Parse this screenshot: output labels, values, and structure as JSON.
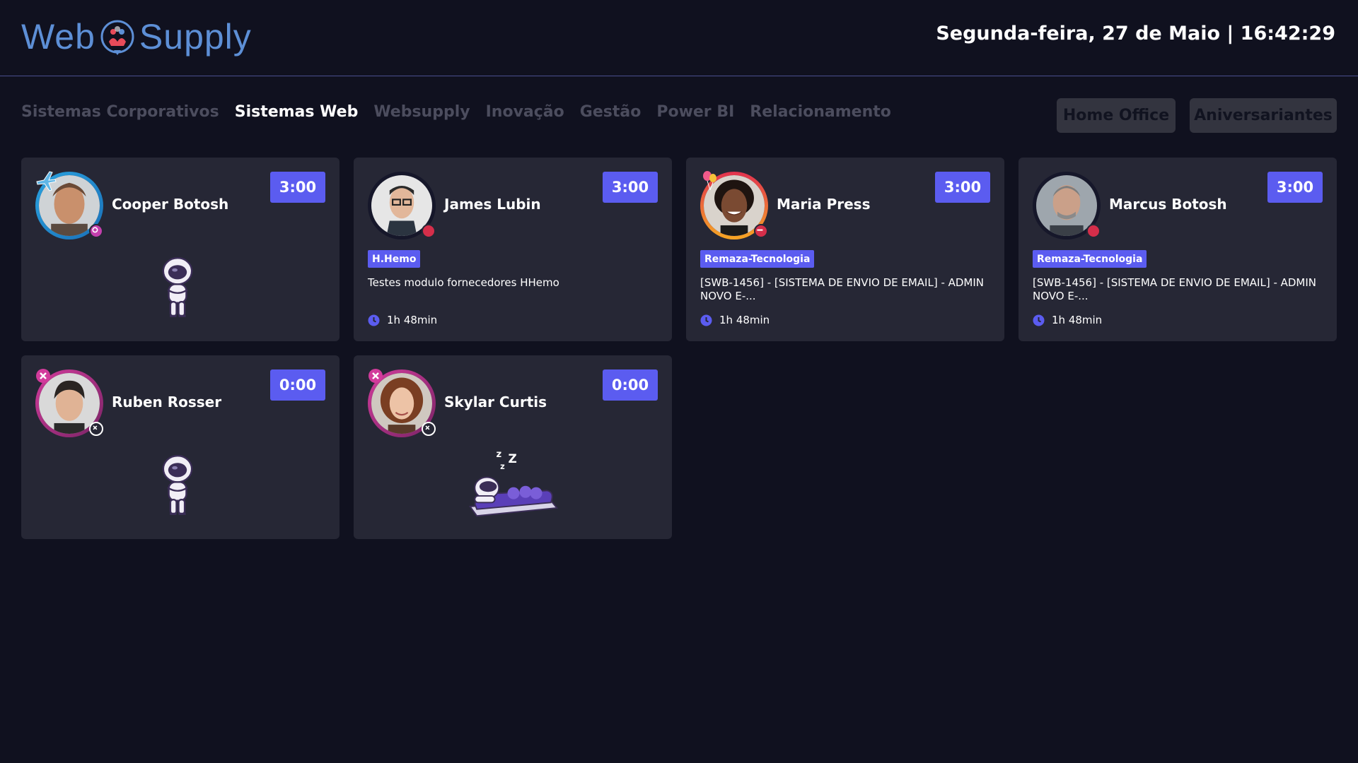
{
  "header": {
    "logo_left": "Web",
    "logo_right": "Supply",
    "datetime": "Segunda-feira, 27 de Maio | 16:42:29"
  },
  "nav": {
    "items": [
      "Sistemas Corporativos",
      "Sistemas Web",
      "Websupply",
      "Inovação",
      "Gestão",
      "Power BI",
      "Relacionamento"
    ],
    "active": "Sistemas Web"
  },
  "buttons": {
    "home_office": "Home Office",
    "aniversariantes": "Aniversariantes"
  },
  "colors": {
    "background": "#10111f",
    "card": "#262735",
    "accent": "#5b5cf0",
    "busy": "#d52e4a",
    "online_ring": "#2aa3e0",
    "absent_ring": "#b4338a",
    "presence_ring": "#f06a2a"
  },
  "cards": [
    {
      "name": "Cooper Botosh",
      "time": "3:00",
      "state": "idle",
      "illustration": "astronaut-standing",
      "corner_icon": "airplane-icon",
      "status_icon": "away-status-icon"
    },
    {
      "name": "James Lubin",
      "time": "3:00",
      "state": "busy",
      "tag": "H.Hemo",
      "task": "Testes modulo fornecedores HHemo",
      "duration": "1h 48min",
      "status_icon": "busy-status-icon"
    },
    {
      "name": "Maria Press",
      "time": "3:00",
      "state": "busy",
      "tag": "Remaza-Tecnologia",
      "task": "[SWB-1456] - [SISTEMA DE ENVIO DE EMAIL] - ADMIN NOVO E-...",
      "duration": "1h 48min",
      "corner_icon": "balloon-icon",
      "status_icon": "dnd-status-icon"
    },
    {
      "name": "Marcus Botosh",
      "time": "3:00",
      "state": "busy",
      "tag": "Remaza-Tecnologia",
      "task": "[SWB-1456] - [SISTEMA DE ENVIO DE EMAIL] - ADMIN NOVO E-...",
      "duration": "1h 48min",
      "status_icon": "busy-status-icon"
    },
    {
      "name": "Ruben Rosser",
      "time": "0:00",
      "state": "offline",
      "illustration": "astronaut-standing",
      "corner_icon": "close-icon",
      "status_icon": "offline-status-icon"
    },
    {
      "name": "Skylar Curtis",
      "time": "0:00",
      "state": "offline",
      "illustration": "astronaut-sleeping",
      "sleep_text": "z z Z",
      "corner_icon": "close-icon",
      "status_icon": "offline-status-icon"
    }
  ]
}
